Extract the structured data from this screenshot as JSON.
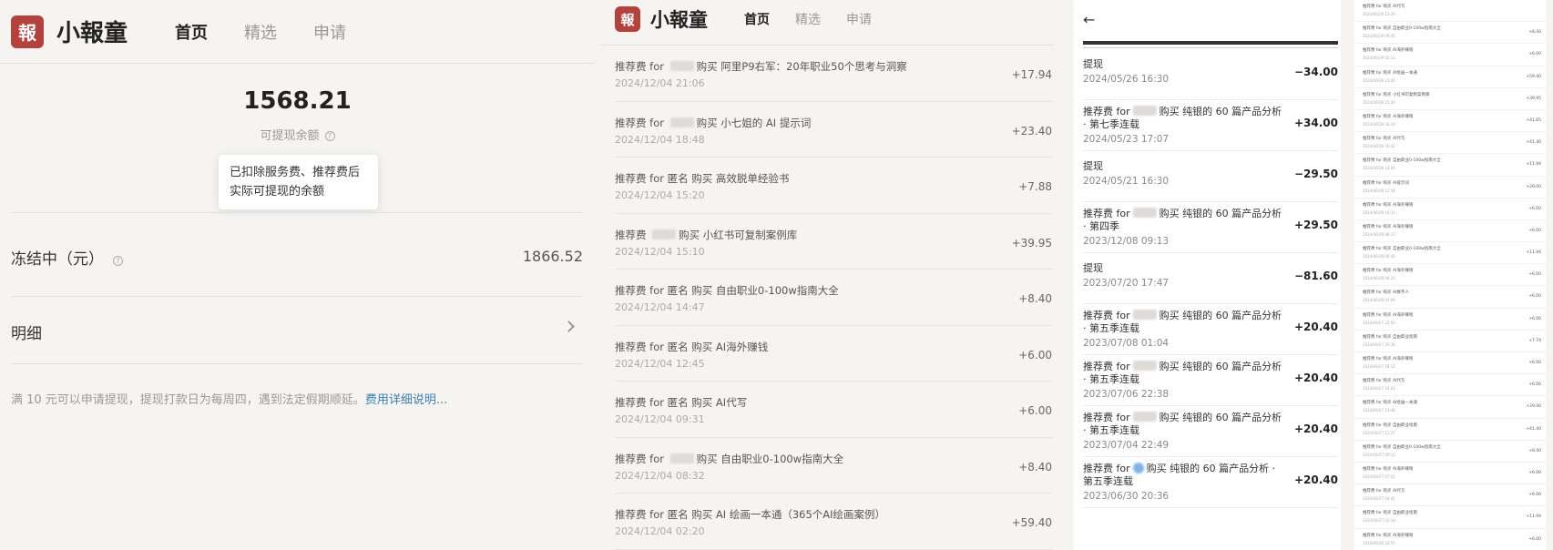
{
  "app": {
    "logo_char": "報",
    "brand": "小報童",
    "nav": [
      "首页",
      "精选",
      "申请"
    ]
  },
  "balance": {
    "amount": "1568.21",
    "label": "可提现余额",
    "tooltip": "已扣除服务费、推荐费后实际可提现的余额"
  },
  "frozen": {
    "label": "冻结中（元）",
    "value": "1866.52"
  },
  "detail": {
    "label": "明细"
  },
  "note": {
    "text": "满 10 元可以申请提现，提现打款日为每周四，遇到法定假期顺延。",
    "link": "费用详细说明..."
  },
  "referrals": [
    {
      "prefix": "推荐费 for ",
      "buyer": "",
      "item": "购买 阿里P9右军：20年职业50个思考与洞察",
      "date": "2024/12/04 21:06",
      "amount": "+17.94"
    },
    {
      "prefix": "推荐费 for ",
      "buyer": "",
      "item": "购买 小七姐的 AI 提示词",
      "date": "2024/12/04 18:48",
      "amount": "+23.40"
    },
    {
      "prefix": "推荐费 for ",
      "buyer": "匿名",
      "item": "购买 高效脱单经验书",
      "date": "2024/12/04 15:20",
      "amount": "+7.88"
    },
    {
      "prefix": "推荐费 ",
      "buyer": "",
      "item": "购买 小红书可复制案例库",
      "date": "2024/12/04 15:10",
      "amount": "+39.95"
    },
    {
      "prefix": "推荐费 for ",
      "buyer": "匿名",
      "item": "购买 自由职业0-100w指南大全",
      "date": "2024/12/04 14:47",
      "amount": "+8.40"
    },
    {
      "prefix": "推荐费 for ",
      "buyer": "匿名",
      "item": "购买 AI海外赚钱",
      "date": "2024/12/04 12:45",
      "amount": "+6.00"
    },
    {
      "prefix": "推荐费 for ",
      "buyer": "匿名",
      "item": "购买 AI代写",
      "date": "2024/12/04 09:31",
      "amount": "+6.00"
    },
    {
      "prefix": "推荐费 for ",
      "buyer": "",
      "item": "购买 自由职业0-100w指南大全",
      "date": "2024/12/04 08:32",
      "amount": "+8.40"
    },
    {
      "prefix": "推荐费 for ",
      "buyer": "匿名",
      "item": "购买 AI 绘画一本通（365个AI绘画案例）",
      "date": "2024/12/04 02:20",
      "amount": "+59.40"
    }
  ],
  "withdrawals": [
    {
      "title": "提现",
      "date": "2024/05/26 16:30",
      "amount": "−34.00",
      "blur": false
    },
    {
      "title": "推荐费 for",
      "title_rest": "购买 纯银的 60 篇产品分析 · 第七季连载",
      "date": "2024/05/23 17:07",
      "amount": "+34.00",
      "blur": true
    },
    {
      "title": "提现",
      "date": "2024/05/21 16:30",
      "amount": "−29.50",
      "blur": false
    },
    {
      "title": "推荐费 for",
      "title_rest": "购买 纯银的 60 篇产品分析 · 第四季",
      "date": "2023/12/08 09:13",
      "amount": "+29.50",
      "blur": true
    },
    {
      "title": "提现",
      "date": "2023/07/20 17:47",
      "amount": "−81.60",
      "blur": false
    },
    {
      "title": "推荐费 for",
      "title_rest": "购买 纯银的 60 篇产品分析 · 第五季连载",
      "date": "2023/07/08 01:04",
      "amount": "+20.40",
      "blur": true
    },
    {
      "title": "推荐费 for",
      "title_rest": "购买 纯银的 60 篇产品分析 · 第五季连载",
      "date": "2023/07/06 22:38",
      "amount": "+20.40",
      "blur": true
    },
    {
      "title": "推荐费 for",
      "title_rest": "购买 纯银的 60 篇产品分析 · 第五季连载",
      "date": "2023/07/04 22:49",
      "amount": "+20.40",
      "blur": true
    },
    {
      "title": "推荐费 for",
      "title_rest": "购买 纯银的 60 篇产品分析 · 第五季连载",
      "date": "2023/06/30 20:36",
      "amount": "+20.40",
      "blur": "blue"
    }
  ],
  "mini": [
    {
      "title": "推荐费 for 购买 AI代写",
      "date": "2024/06/29 13:20",
      "amount": ""
    },
    {
      "title": "推荐费 for 购买 自由职业0-100w指南大全",
      "date": "2024/06/29 09:45",
      "amount": "+8.40"
    },
    {
      "title": "推荐费 for 购买 AI海外赚钱",
      "date": "2024/06/29 02:13",
      "amount": "+6.00"
    },
    {
      "title": "推荐费 for 购买 AI绘画一本通",
      "date": "2024/06/28 23:41",
      "amount": "+59.40"
    },
    {
      "title": "推荐费 for 购买 小红书可复制案例库",
      "date": "2024/06/28 21:30",
      "amount": "+39.95"
    },
    {
      "title": "推荐费 for 购买 AI海外赚钱",
      "date": "2024/06/28 18:14",
      "amount": "+41.65"
    },
    {
      "title": "推荐费 for 购买 AI代写",
      "date": "2024/06/28 16:42",
      "amount": "+41.40"
    },
    {
      "title": "推荐费 for 购买 自由职业0-100w指南大全",
      "date": "2024/06/28 14:06",
      "amount": "+11.94"
    },
    {
      "title": "推荐费 for 购买 AI提示词",
      "date": "2024/06/28 12:58",
      "amount": "+29.00"
    },
    {
      "title": "推荐费 for 购买 AI海外赚钱",
      "date": "2024/06/28 10:31",
      "amount": "+6.00"
    },
    {
      "title": "推荐费 for 购买 AI海外赚钱",
      "date": "2024/06/28 08:17",
      "amount": "+6.00"
    },
    {
      "title": "推荐费 for 购买 自由职业0-100w指南大全",
      "date": "2024/06/28 06:45",
      "amount": "+11.94"
    },
    {
      "title": "推荐费 for 购买 AI海外赚钱",
      "date": "2024/06/28 04:22",
      "amount": "+6.00"
    },
    {
      "title": "推荐费 for 购买 AI数字人",
      "date": "2024/06/28 01:09",
      "amount": "+6.00"
    },
    {
      "title": "推荐费 for 购买 AI海外赚钱",
      "date": "2024/06/27 22:50",
      "amount": "+6.00"
    },
    {
      "title": "推荐费 for 购买 自由职业指南",
      "date": "2024/06/27 20:36",
      "amount": "+7.74"
    },
    {
      "title": "推荐费 for 购买 AI海外赚钱",
      "date": "2024/06/27 18:12",
      "amount": "+6.00"
    },
    {
      "title": "推荐费 for 购买 AI代写",
      "date": "2024/06/27 16:03",
      "amount": "+6.00"
    },
    {
      "title": "推荐费 for 购买 AI绘画一本通",
      "date": "2024/06/27 13:48",
      "amount": "+29.00"
    },
    {
      "title": "推荐费 for 购买 自由职业指南",
      "date": "2024/06/27 11:27",
      "amount": "+41.40"
    },
    {
      "title": "推荐费 for 购买 自由职业0-100w指南大全",
      "date": "2024/06/27 09:15",
      "amount": "+8.40"
    },
    {
      "title": "推荐费 for 购买 AI海外赚钱",
      "date": "2024/06/27 07:02",
      "amount": "+6.00"
    },
    {
      "title": "推荐费 for 购买 AI代写",
      "date": "2024/06/27 04:41",
      "amount": "+6.00"
    },
    {
      "title": "推荐费 for 购买 自由职业指南",
      "date": "2024/06/27 02:18",
      "amount": "+11.94"
    },
    {
      "title": "推荐费 for 购买 AI海外赚钱",
      "date": "2024/06/26 23:55",
      "amount": "+6.00"
    }
  ]
}
